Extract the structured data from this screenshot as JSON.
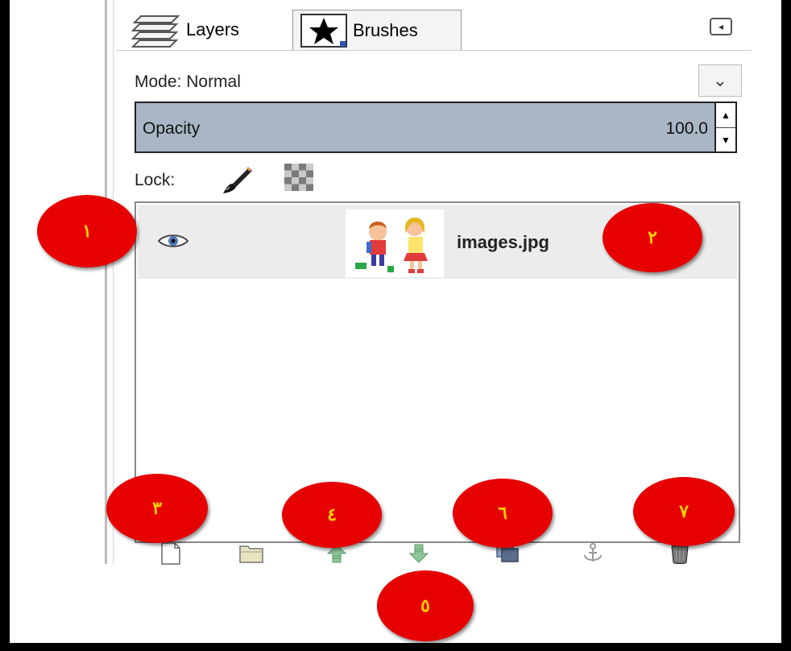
{
  "tabs": {
    "layers_label": "Layers",
    "brushes_label": "Brushes"
  },
  "mode": {
    "label": "Mode:",
    "value": "Normal"
  },
  "opacity": {
    "label": "Opacity",
    "value": "100.0"
  },
  "lock": {
    "label": "Lock:"
  },
  "layers": [
    {
      "name": "images.jpg",
      "visible": true
    }
  ],
  "footer_icons": [
    "new-layer-icon",
    "new-layer-group-icon",
    "raise-layer-icon",
    "lower-layer-icon",
    "duplicate-layer-icon",
    "anchor-layer-icon",
    "delete-layer-icon"
  ],
  "markers": [
    "١",
    "٢",
    "٣",
    "٤",
    "٥",
    "٦",
    "٧"
  ],
  "colors": {
    "opacity_bar": "#a9b6c5",
    "marker_fill": "#e60000",
    "marker_text": "#ffd200",
    "layer_row": "#ececec"
  }
}
